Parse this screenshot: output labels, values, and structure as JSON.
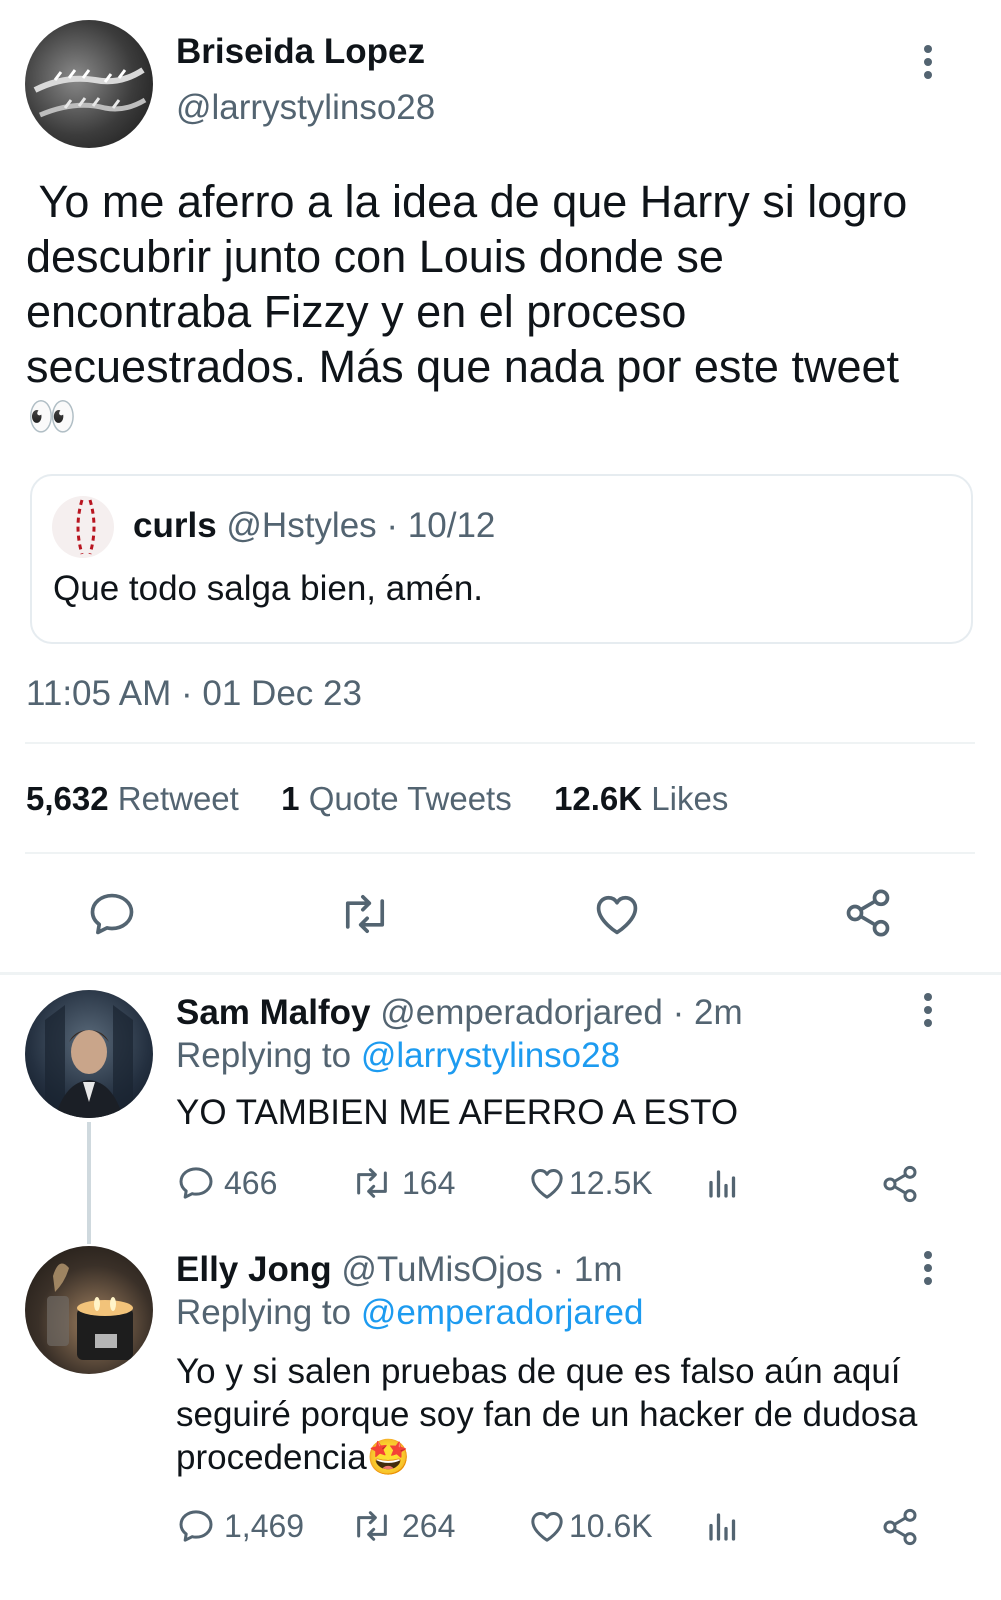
{
  "main_tweet": {
    "author_name": "Briseida Lopez",
    "author_handle": "@larrystylinso28",
    "text": " Yo me aferro a la idea de que Harry si logro descubrir junto con Louis donde se encontraba Fizzy y en el proceso secuestrados. Más que nada por este tweet",
    "emoji": "👀",
    "quoted": {
      "name": "curls",
      "handle": "@Hstyles",
      "date": "· 10/12",
      "text": "Que todo salga bien, amén."
    },
    "timestamp": "11:05 AM · 01 Dec 23",
    "stats": {
      "retweets_count": "5,632",
      "retweets_label": "Retweet",
      "quotes_count": "1",
      "quotes_label": "Quote Tweets",
      "likes_count": "12.6K",
      "likes_label": "Likes"
    }
  },
  "replies": [
    {
      "name": "Sam Malfoy",
      "handle": "@emperadorjared",
      "time": "· 2m",
      "replying_prefix": "Replying to",
      "replying_to": "@larrystylinso28",
      "text": "YO TAMBIEN ME AFERRO A ESTO",
      "replies": "466",
      "retweets": "164",
      "likes": "12.5K"
    },
    {
      "name": "Elly Jong",
      "handle": "@TuMisOjos",
      "time": "· 1m",
      "replying_prefix": "Replying to",
      "replying_to": "@emperadorjared",
      "text": "Yo y si salen pruebas de que es falso aún aquí seguiré porque soy fan de un hacker de dudosa procedencia",
      "emoji": "🤩",
      "replies": "1,469",
      "retweets": "264",
      "likes": "10.6K"
    }
  ],
  "icons": {
    "reply": "reply-bubble-icon",
    "retweet": "retweet-icon",
    "like": "heart-icon",
    "share": "share-icon",
    "analytics": "analytics-icon",
    "more": "more-options-icon"
  },
  "colors": {
    "text": "#0f1419",
    "muted": "#536471",
    "link": "#1d9bf0",
    "divider": "#eff3f4"
  }
}
